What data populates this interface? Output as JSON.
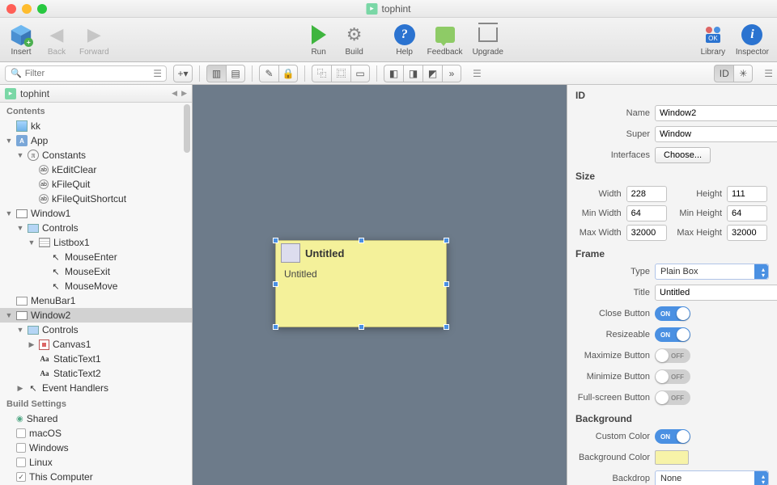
{
  "title": "tophint",
  "toolbar": {
    "insert": "Insert",
    "back": "Back",
    "forward": "Forward",
    "run": "Run",
    "build": "Build",
    "help": "Help",
    "feedback": "Feedback",
    "upgrade": "Upgrade",
    "library": "Library",
    "inspector": "Inspector"
  },
  "filter": {
    "placeholder": "Filter"
  },
  "sidebar": {
    "header": "tophint",
    "contents": "Contents",
    "tree": {
      "kk": "kk",
      "app": "App",
      "constants": "Constants",
      "kEditClear": "kEditClear",
      "kFileQuit": "kFileQuit",
      "kFileQuitShortcut": "kFileQuitShortcut",
      "window1": "Window1",
      "controls": "Controls",
      "listbox1": "Listbox1",
      "mouseEnter": "MouseEnter",
      "mouseExit": "MouseExit",
      "mouseMove": "MouseMove",
      "menubar1": "MenuBar1",
      "window2": "Window2",
      "canvas1": "Canvas1",
      "st1": "StaticText1",
      "st2": "StaticText2",
      "eventHandlers": "Event Handlers"
    },
    "buildSettings": "Build Settings",
    "targets": {
      "shared": "Shared",
      "macos": "macOS",
      "windows": "Windows",
      "linux": "Linux",
      "thisComputer": "This Computer"
    }
  },
  "canvas": {
    "title": "Untitled",
    "body": "Untitled"
  },
  "inspector": {
    "id": {
      "section": "ID",
      "name_lbl": "Name",
      "name_val": "Window2",
      "super_lbl": "Super",
      "super_val": "Window",
      "interfaces_lbl": "Interfaces",
      "choose": "Choose..."
    },
    "size": {
      "section": "Size",
      "w_lbl": "Width",
      "w": "228",
      "h_lbl": "Height",
      "h": "111",
      "minw_lbl": "Min Width",
      "minw": "64",
      "minh_lbl": "Min Height",
      "minh": "64",
      "maxw_lbl": "Max Width",
      "maxw": "32000",
      "maxh_lbl": "Max Height",
      "maxh": "32000"
    },
    "frame": {
      "section": "Frame",
      "type_lbl": "Type",
      "type": "Plain Box",
      "title_lbl": "Title",
      "title": "Untitled",
      "close_lbl": "Close Button",
      "resize_lbl": "Resizeable",
      "max_lbl": "Maximize Button",
      "min_lbl": "Minimize Button",
      "fs_lbl": "Full-screen Button",
      "on": "ON",
      "off": "OFF"
    },
    "bg": {
      "section": "Background",
      "custom_lbl": "Custom Color",
      "bgcolor_lbl": "Background Color",
      "backdrop_lbl": "Backdrop",
      "backdrop": "None"
    }
  }
}
